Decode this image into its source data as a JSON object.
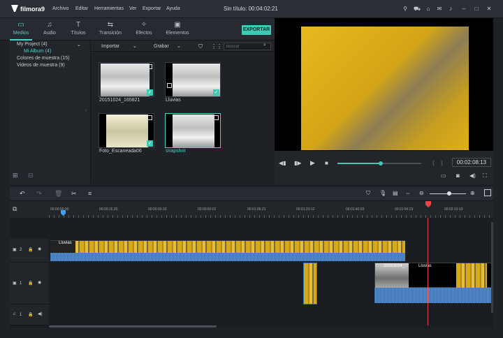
{
  "app": {
    "logo_text": "filmora9",
    "window_title": "Sin título:",
    "window_time": "00:04:02:21"
  },
  "menu": [
    "Archivo",
    "Editar",
    "Herramientas",
    "Ver",
    "Exportar",
    "Ayuda"
  ],
  "toolbar": {
    "tabs": [
      {
        "label": "Medios",
        "icon": "folder-icon",
        "active": true
      },
      {
        "label": "Audio",
        "icon": "music-note-icon"
      },
      {
        "label": "Títulos",
        "icon": "text-icon"
      },
      {
        "label": "Transición",
        "icon": "transition-icon"
      },
      {
        "label": "Efectos",
        "icon": "effects-icon"
      },
      {
        "label": "Elementos",
        "icon": "image-icon"
      }
    ],
    "export_label": "EXPORTAR"
  },
  "sidebar": {
    "items": [
      {
        "label": "My Project (4)"
      },
      {
        "label": "Mi Album (4)",
        "selected": true
      },
      {
        "label": "Colores de muestra (15)"
      },
      {
        "label": "Videos de muestra (9)"
      }
    ]
  },
  "media_bar": {
    "import_label": "Importar",
    "record_label": "Grabar",
    "search_placeholder": "Buscar"
  },
  "media_items": [
    {
      "name": "20151024_165821",
      "checked": true
    },
    {
      "name": "Lluvias",
      "checked": true
    },
    {
      "name": "Foto_Escaneada06",
      "checked": true
    },
    {
      "name": "snapshot",
      "selected": true
    }
  ],
  "preview": {
    "time": "00:02:08:13",
    "progress": 0.52
  },
  "ruler": {
    "labels": [
      "00:00:00:00",
      "00:00:16:20",
      "00:00:33:10",
      "00:00:50:01",
      "00:01:06:21",
      "00:01:23:12",
      "00:01:40:03",
      "00:01:56:23",
      "00:02:13:13"
    ]
  },
  "tracks": [
    {
      "label": "2",
      "type": "video"
    },
    {
      "label": "1",
      "type": "video"
    },
    {
      "label": "1",
      "type": "audio"
    }
  ],
  "clips": {
    "track2_title": "Lluvias",
    "track1_title_a": "20151024_",
    "track1_title_b": "Lluvias"
  },
  "colors": {
    "accent": "#40c9b5",
    "playhead": "#e84545",
    "clip_yellow": "#d6a91a",
    "audio_blue": "#3b6fae"
  }
}
